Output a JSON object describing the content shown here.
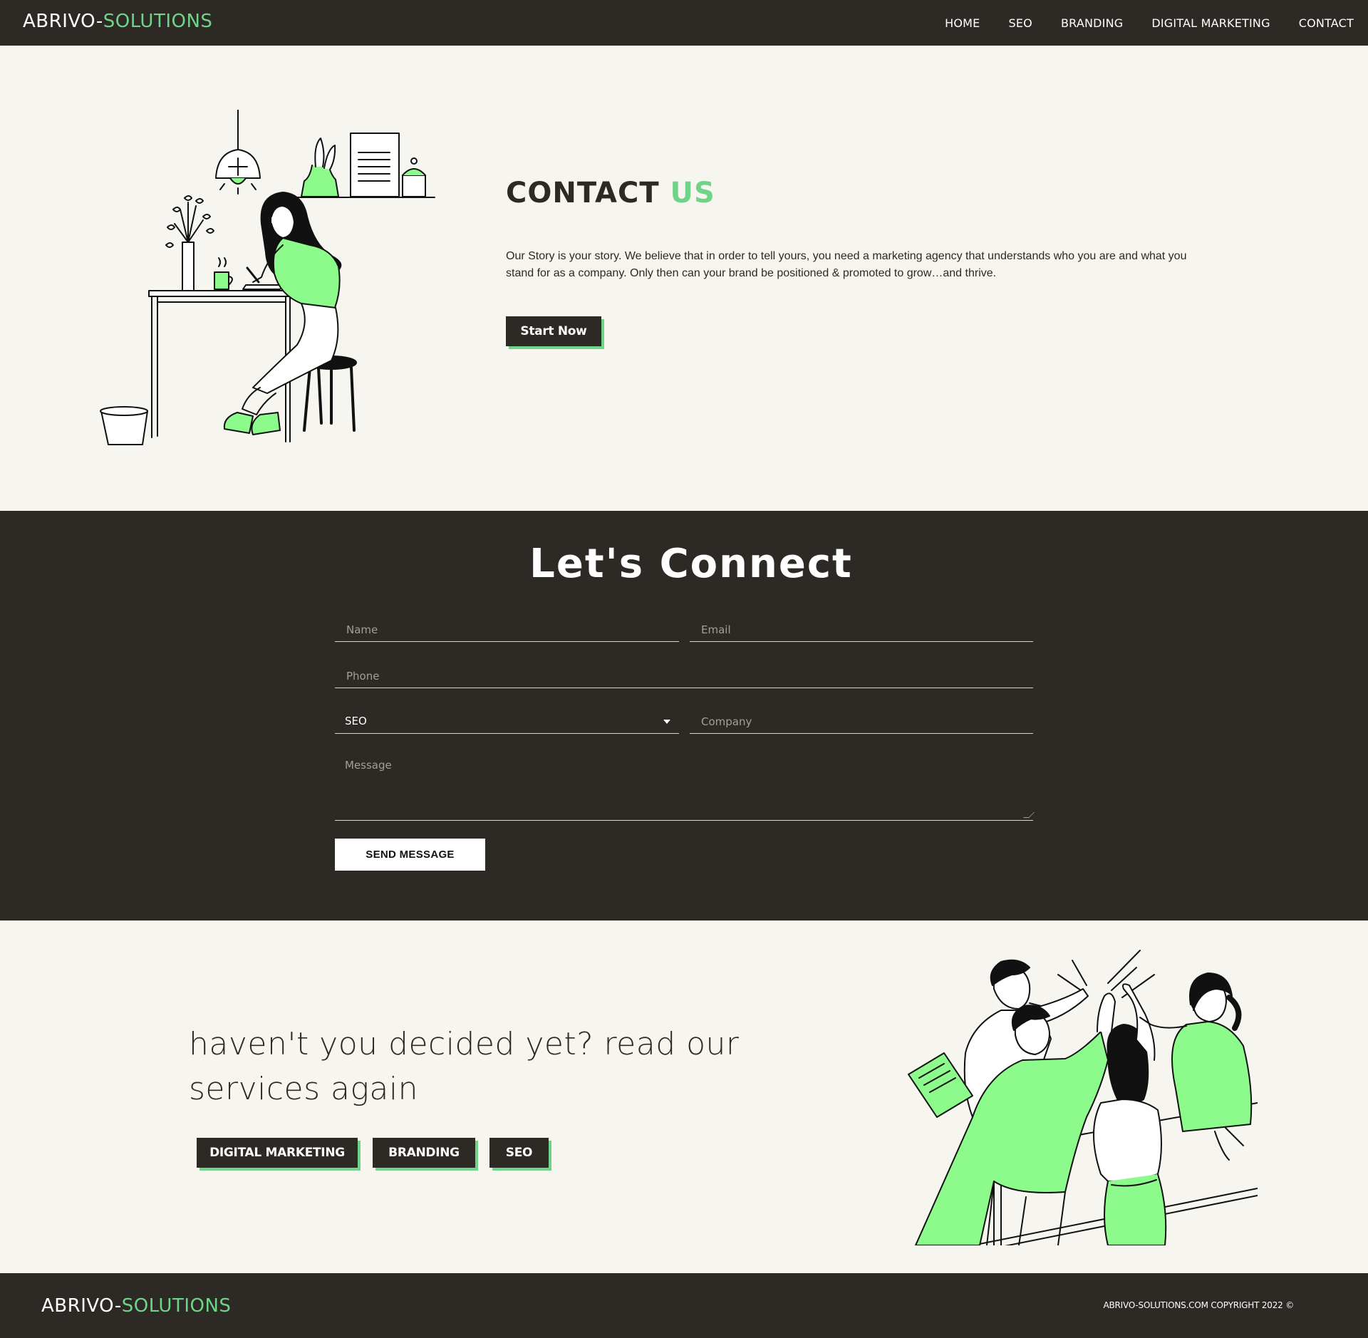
{
  "brand": {
    "name_part1": "ABRIVO-",
    "name_part2": "SOLUTIONS"
  },
  "nav": {
    "items": [
      "HOME",
      "SEO",
      "BRANDING",
      "DIGITAL MARKETING",
      "CONTACT"
    ]
  },
  "hero": {
    "title_part1": "CONTACT ",
    "title_part2": "US",
    "text": "Our Story is your story. We believe that in order to tell yours, you need a marketing agency that understands who you are and what you stand for as a company. Only then can your brand be positioned & promoted to grow…and thrive.",
    "cta_label": "Start Now"
  },
  "connect": {
    "title": "Let's Connect",
    "name_placeholder": "Name",
    "email_placeholder": "Email",
    "phone_placeholder": "Phone",
    "service_value": "SEO",
    "company_placeholder": "Company",
    "message_placeholder": "Message",
    "send_label": "SEND MESSAGE"
  },
  "services": {
    "heading": "haven't you decided yet? read our services again",
    "buttons": [
      "DIGITAL MARKETING",
      "BRANDING",
      "SEO"
    ]
  },
  "footer": {
    "copyright": "ABRIVO-SOLUTIONS.COM COPYRIGHT 2022 ©"
  },
  "colors": {
    "dark": "#2d2a26",
    "accent": "#6fd48a",
    "background": "#f7f5ef",
    "illustration_green": "#8cfb8c"
  }
}
